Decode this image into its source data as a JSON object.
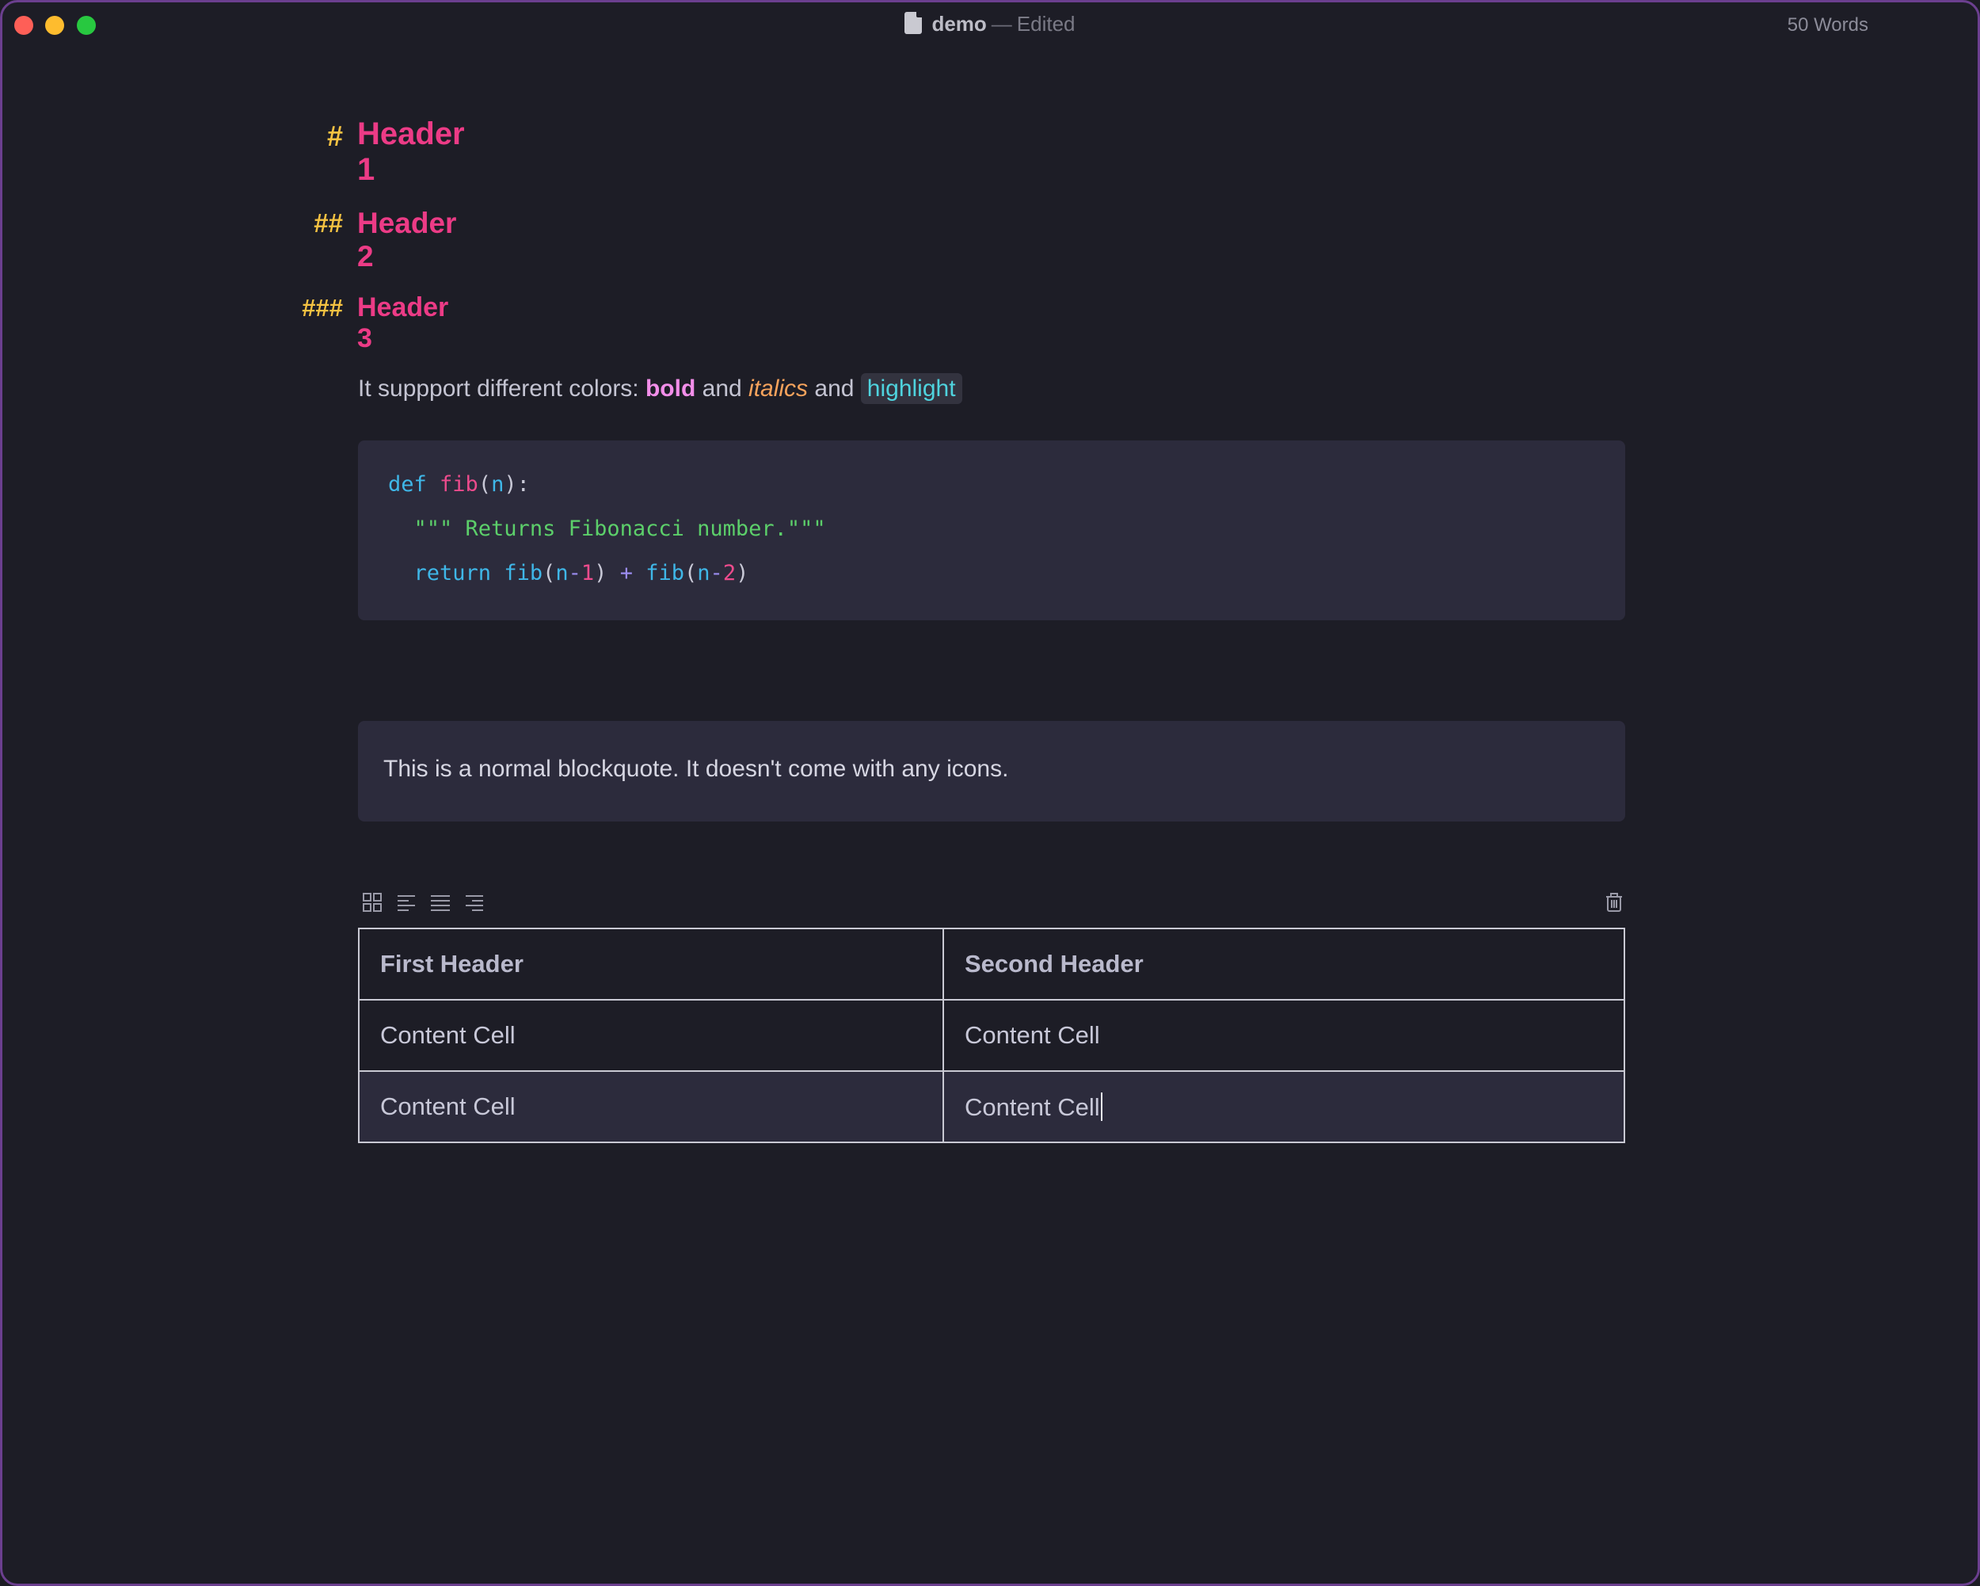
{
  "window": {
    "document_name": "demo",
    "separator": "—",
    "status": "Edited",
    "word_count": "50 Words"
  },
  "headers": [
    {
      "marker": "#",
      "text": "Header 1"
    },
    {
      "marker": "##",
      "text": "Header 2"
    },
    {
      "marker": "###",
      "text": "Header 3"
    }
  ],
  "paragraph": {
    "prefix": "It suppport different colors: ",
    "bold": "bold",
    "and1": " and ",
    "italic": "italics",
    "and2": " and ",
    "highlight": "highlight"
  },
  "code": {
    "language": "python",
    "lines": [
      "def fib(n):",
      "  \"\"\" Returns Fibonacci number.\"\"\"",
      "  return fib(n-1) + fib(n-2)"
    ],
    "tokens": {
      "def": "def",
      "fib": "fib",
      "n": "n",
      "docstring": "\"\"\" Returns Fibonacci number.\"\"\"",
      "return": "return",
      "one": "1",
      "two": "2",
      "plus": "+",
      "minus": "-"
    }
  },
  "blockquote": "This is a normal blockquote. It doesn't come with any icons.",
  "table": {
    "headers": [
      "First Header",
      "Second Header"
    ],
    "rows": [
      [
        "Content Cell",
        "Content Cell"
      ],
      [
        "Content Cell",
        "Content Cell"
      ]
    ]
  },
  "icons": {
    "table_toolbar": [
      "grid-icon",
      "align-left-icon",
      "align-center-icon",
      "align-right-icon",
      "trash-icon"
    ],
    "window_controls": [
      "close-button",
      "minimize-button",
      "maximize-button"
    ]
  },
  "colors": {
    "background": "#1d1d26",
    "header": "#ec3b86",
    "header_marker": "#f5c242",
    "bold": "#f28ee9",
    "italic": "#f7a35c",
    "highlight": "#4fd3de",
    "code_bg": "#2c2b3c"
  }
}
